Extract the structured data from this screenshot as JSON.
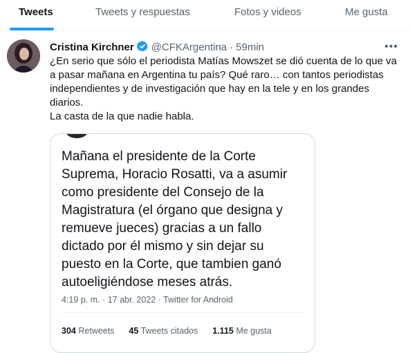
{
  "tabs": [
    {
      "label": "Tweets",
      "active": true
    },
    {
      "label": "Tweets y respuestas",
      "active": false
    },
    {
      "label": "Fotos y videos",
      "active": false
    },
    {
      "label": "Me gusta",
      "active": false
    }
  ],
  "tweet": {
    "author": "Cristina Kirchner",
    "handle": "@CFKArgentina",
    "separator": "·",
    "time": "59min",
    "more_icon": "more-horizontal-icon",
    "verified_icon": "verified-badge-icon",
    "text_lines": [
      "¿En serio que sólo el periodista Matías Mowszet se dió cuenta de lo que va",
      "a pasar mañana en Argentina tu país? Qué raro… con tantos periodistas",
      "independientes y de investigación que hay en la tele y en los grandes",
      "diarios.",
      "La casta de la que nadie habla."
    ]
  },
  "media": {
    "lines": [
      "Mañana el presidente de la Corte",
      "Suprema, Horacio Rosatti, va a asumir",
      "como presidente del Consejo de la",
      "Magistratura (el órgano que designa y",
      "remueve jueces) gracias a un fallo",
      "dictado por él mismo y sin dejar su",
      "puesto en la Corte, que tambien ganó",
      "autoeligiéndose meses atrás."
    ],
    "meta": "4:19 p. m. · 17 abr. 2022 · Twitter for Android",
    "stats": [
      {
        "value": "304",
        "label": "Retweets"
      },
      {
        "value": "45",
        "label": "Tweets citados"
      },
      {
        "value": "1.115",
        "label": "Me gusta"
      }
    ]
  },
  "colors": {
    "accent": "#1d9bf0",
    "text": "#0f1419",
    "muted": "#536471",
    "border": "#cfd9de"
  }
}
